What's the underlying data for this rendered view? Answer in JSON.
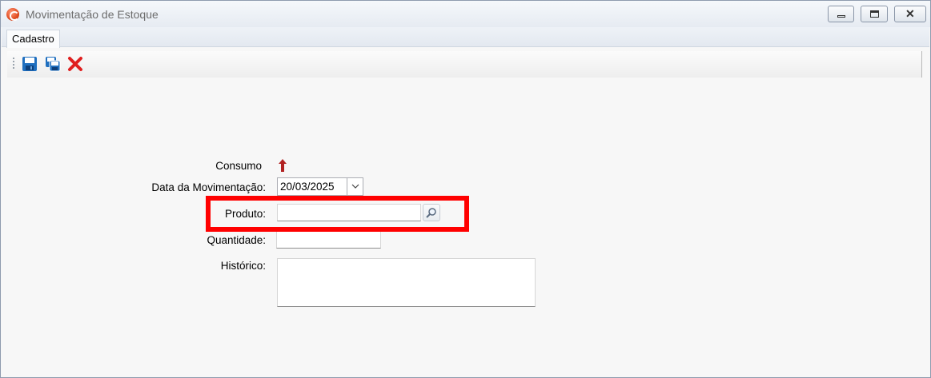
{
  "window": {
    "title": "Movimentação de Estoque",
    "icon": "app-logo-icon",
    "controls": [
      "minimize",
      "maximize",
      "close"
    ]
  },
  "menu": {
    "tabs": [
      {
        "label": "Cadastro"
      }
    ]
  },
  "toolbar": {
    "buttons": [
      {
        "name": "save",
        "icon": "floppy-disk-icon",
        "color": "#1f6fbf"
      },
      {
        "name": "save-copy",
        "icon": "copy-save-icon",
        "color": "#1f6fbf"
      },
      {
        "name": "delete",
        "icon": "red-x-icon",
        "color": "#e02020"
      }
    ]
  },
  "form": {
    "consumo": {
      "label": "Consumo",
      "icon": "arrow-up-icon",
      "icon_color": "#b22222"
    },
    "data_movimentacao": {
      "label": "Data da Movimentação:",
      "value": "20/03/2025"
    },
    "produto": {
      "label": "Produto:",
      "value": ""
    },
    "quantidade": {
      "label": "Quantidade:",
      "value": ""
    },
    "historico": {
      "label": "Histórico:",
      "value": ""
    }
  },
  "highlight_color": "#ff0000"
}
